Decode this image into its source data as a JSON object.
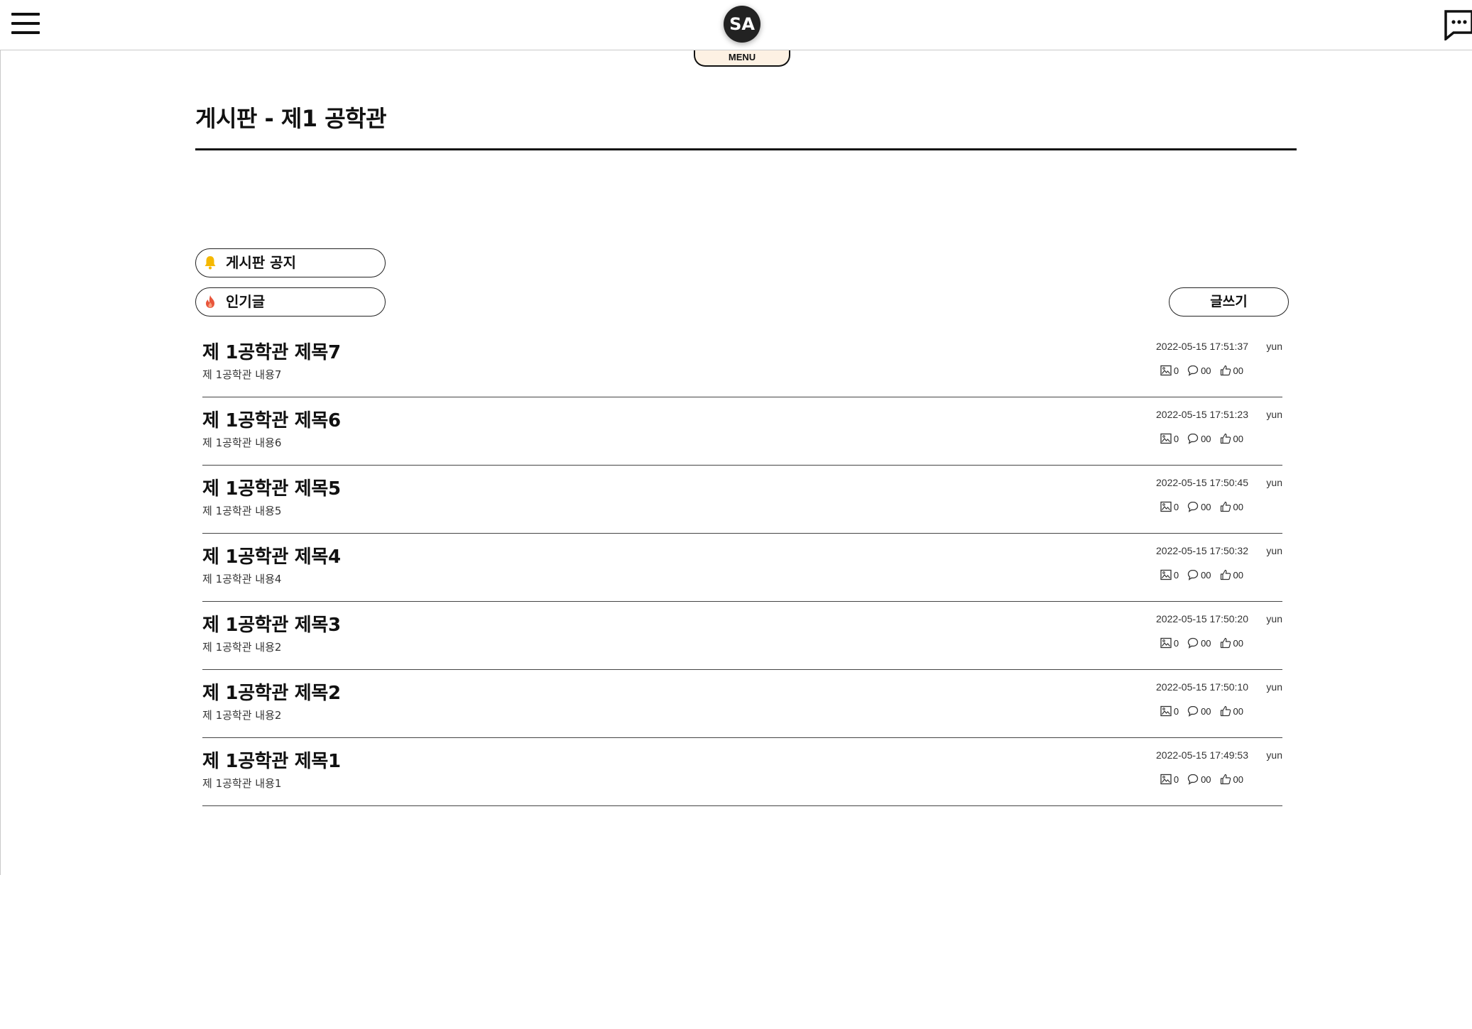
{
  "header": {
    "logo_text": "SA",
    "menu_tab_label": "MENU"
  },
  "board": {
    "title": "게시판 - 제1 공학관",
    "notice_label": "게시판 공지",
    "popular_label": "인기글",
    "write_button_label": "글쓰기"
  },
  "colors": {
    "notice_icon": "#f5b800",
    "popular_icon": "#e8553b",
    "menu_tab_bg": "#fdf1e3"
  },
  "posts": [
    {
      "title": "제 1공학관 제목7",
      "body": "제 1공학관 내용7",
      "date": "2022-05-15 17:51:37",
      "author": "yun",
      "images": "0",
      "comments": "00",
      "likes": "00"
    },
    {
      "title": "제 1공학관 제목6",
      "body": "제 1공학관 내용6",
      "date": "2022-05-15 17:51:23",
      "author": "yun",
      "images": "0",
      "comments": "00",
      "likes": "00"
    },
    {
      "title": "제 1공학관 제목5",
      "body": "제 1공학관 내용5",
      "date": "2022-05-15 17:50:45",
      "author": "yun",
      "images": "0",
      "comments": "00",
      "likes": "00"
    },
    {
      "title": "제 1공학관 제목4",
      "body": "제 1공학관 내용4",
      "date": "2022-05-15 17:50:32",
      "author": "yun",
      "images": "0",
      "comments": "00",
      "likes": "00"
    },
    {
      "title": "제 1공학관 제목3",
      "body": "제 1공학관 내용2",
      "date": "2022-05-15 17:50:20",
      "author": "yun",
      "images": "0",
      "comments": "00",
      "likes": "00"
    },
    {
      "title": "제 1공학관 제목2",
      "body": "제 1공학관 내용2",
      "date": "2022-05-15 17:50:10",
      "author": "yun",
      "images": "0",
      "comments": "00",
      "likes": "00"
    },
    {
      "title": "제 1공학관 제목1",
      "body": "제 1공학관 내용1",
      "date": "2022-05-15 17:49:53",
      "author": "yun",
      "images": "0",
      "comments": "00",
      "likes": "00"
    }
  ]
}
